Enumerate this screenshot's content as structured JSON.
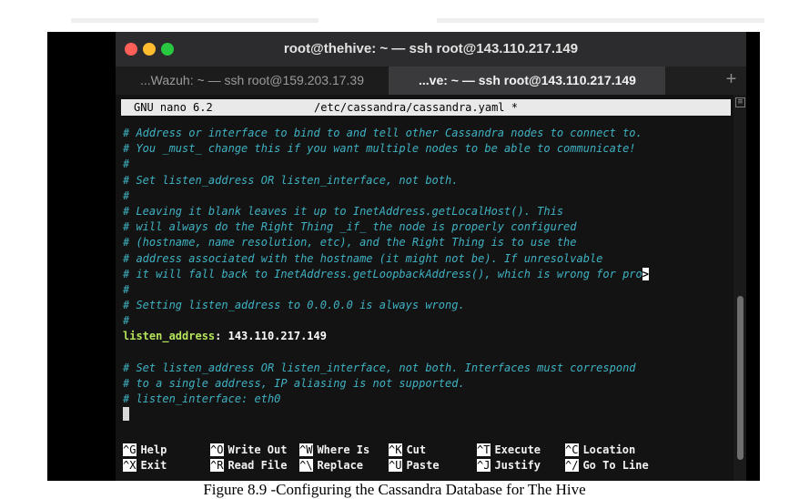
{
  "window": {
    "title": "root@thehive: ~ — ssh root@143.110.217.149",
    "tabs": [
      {
        "label": "...Wazuh: ~ — ssh root@159.203.17.39"
      },
      {
        "label": "...ve: ~ — ssh root@143.110.217.149"
      }
    ],
    "new_tab_symbol": "+"
  },
  "nano": {
    "app_version": "GNU nano 6.2",
    "file_title": "/etc/cassandra/cassandra.yaml *"
  },
  "buffer": {
    "lines": [
      {
        "type": "comment",
        "text": "# Address or interface to bind to and tell other Cassandra nodes to connect to."
      },
      {
        "type": "comment",
        "text": "# You _must_ change this if you want multiple nodes to be able to communicate!"
      },
      {
        "type": "comment",
        "text": "#"
      },
      {
        "type": "comment",
        "text": "# Set listen_address OR listen_interface, not both."
      },
      {
        "type": "comment",
        "text": "#"
      },
      {
        "type": "comment",
        "text": "# Leaving it blank leaves it up to InetAddress.getLocalHost(). This"
      },
      {
        "type": "comment",
        "text": "# will always do the Right Thing _if_ the node is properly configured"
      },
      {
        "type": "comment",
        "text": "# (hostname, name resolution, etc), and the Right Thing is to use the"
      },
      {
        "type": "comment",
        "text": "# address associated with the hostname (it might not be). If unresolvable"
      },
      {
        "type": "comment",
        "text": "# it will fall back to InetAddress.getLoopbackAddress(), which is wrong for pro",
        "overflow": ">"
      },
      {
        "type": "comment",
        "text": "#"
      },
      {
        "type": "comment",
        "text": "# Setting listen_address to 0.0.0.0 is always wrong."
      },
      {
        "type": "comment",
        "text": "#"
      },
      {
        "type": "setting",
        "key": "listen_address",
        "sep": ": ",
        "value": "143.110.217.149"
      },
      {
        "type": "blank",
        "text": ""
      },
      {
        "type": "comment",
        "text": "# Set listen_address OR listen_interface, not both. Interfaces must correspond"
      },
      {
        "type": "comment",
        "text": "# to a single address, IP aliasing is not supported."
      },
      {
        "type": "comment",
        "text": "# listen_interface: eth0"
      },
      {
        "type": "cursor",
        "text": ""
      }
    ]
  },
  "shortcuts": {
    "row1": [
      {
        "key": "^G",
        "label": "Help"
      },
      {
        "key": "^O",
        "label": "Write Out"
      },
      {
        "key": "^W",
        "label": "Where Is"
      },
      {
        "key": "^K",
        "label": "Cut"
      },
      {
        "key": "^T",
        "label": "Execute"
      },
      {
        "key": "^C",
        "label": "Location"
      }
    ],
    "row2": [
      {
        "key": "^X",
        "label": "Exit"
      },
      {
        "key": "^R",
        "label": "Read File"
      },
      {
        "key": "^\\",
        "label": "Replace"
      },
      {
        "key": "^U",
        "label": "Paste"
      },
      {
        "key": "^J",
        "label": "Justify"
      },
      {
        "key": "^/",
        "label": "Go To Line"
      }
    ]
  },
  "caption": "Figure 8.9 -Configuring the Cassandra Database for The Hive",
  "colors": {
    "comment": "#3fb2c3",
    "setting_key": "#b5e35b",
    "setting_value": "#ffffff",
    "close": "#ff5f57",
    "minimize": "#febc2e",
    "zoom": "#28c840"
  }
}
